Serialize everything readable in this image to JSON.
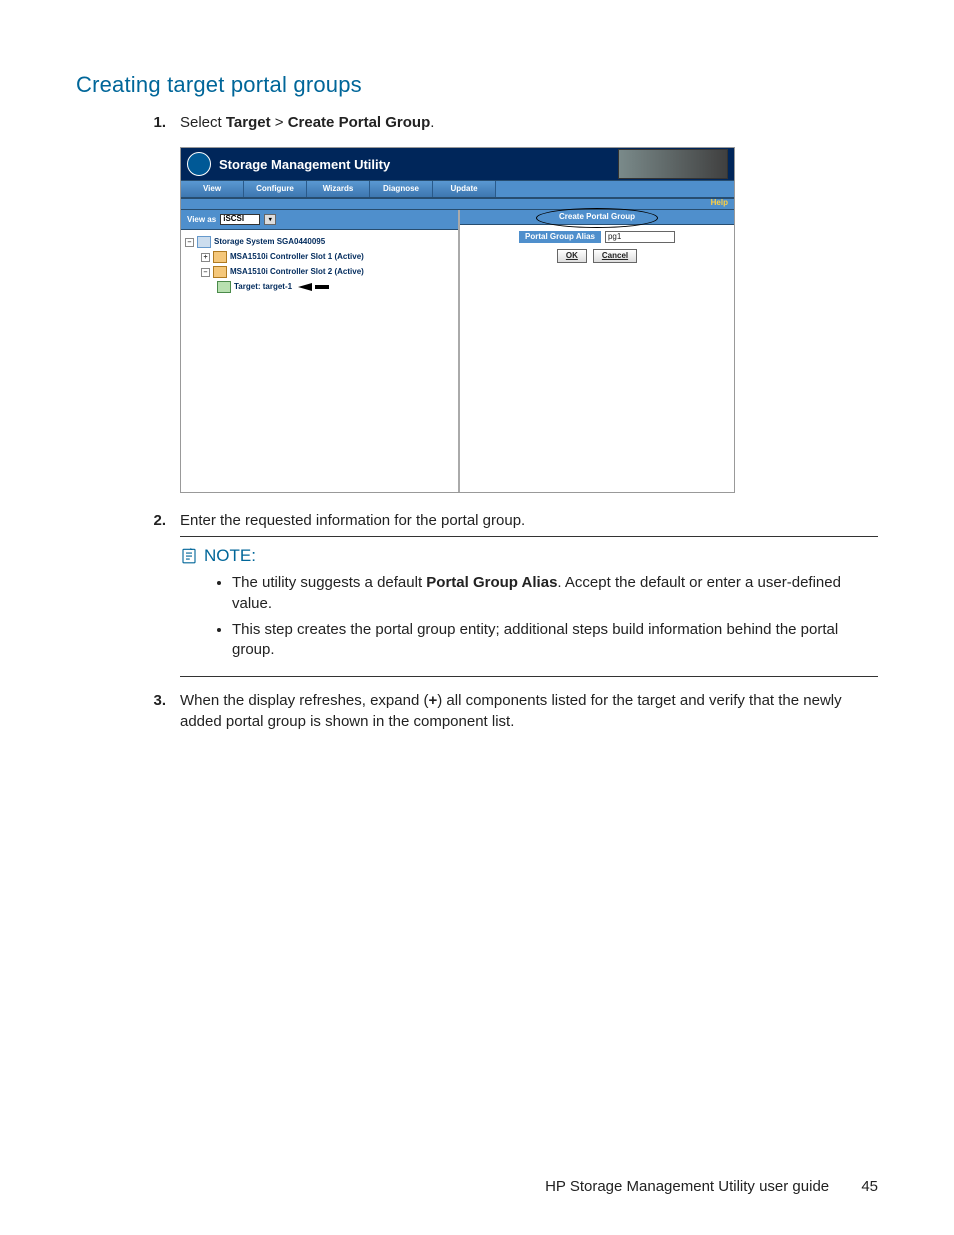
{
  "heading": "Creating target portal groups",
  "step1": {
    "prefix": "Select ",
    "target": "Target",
    "gt": " > ",
    "action": "Create Portal Group",
    "suffix": "."
  },
  "step2": "Enter the requested information for the portal group.",
  "step3_a": "When the display refreshes, expand (",
  "step3_plus": "+",
  "step3_b": ") all components listed for the target and verify that the newly added portal group is shown in the component list.",
  "note": {
    "label": "NOTE:",
    "b1_a": "The utility suggests a default ",
    "b1_bold": "Portal Group Alias",
    "b1_b": ".  Accept the default or enter a user-defined value.",
    "b2": "This step creates the portal group entity; additional steps build information behind the portal group."
  },
  "footer": {
    "text": "HP Storage Management Utility user guide",
    "page": "45"
  },
  "shot": {
    "title": "Storage Management Utility",
    "menu": [
      "View",
      "Configure",
      "Wizards",
      "Diagnose",
      "Update"
    ],
    "help": "Help",
    "viewas_label": "View as",
    "viewas_value": "iSCSI",
    "tree": {
      "sys": "Storage System SGA0440095",
      "c1": "MSA1510i Controller Slot 1 (Active)",
      "c2": "MSA1510i Controller Slot 2 (Active)",
      "tgt": "Target: target-1"
    },
    "panel_title": "Create Portal Group",
    "form_label": "Portal Group Alias",
    "form_value": "pg1",
    "ok": "OK",
    "cancel": "Cancel"
  }
}
